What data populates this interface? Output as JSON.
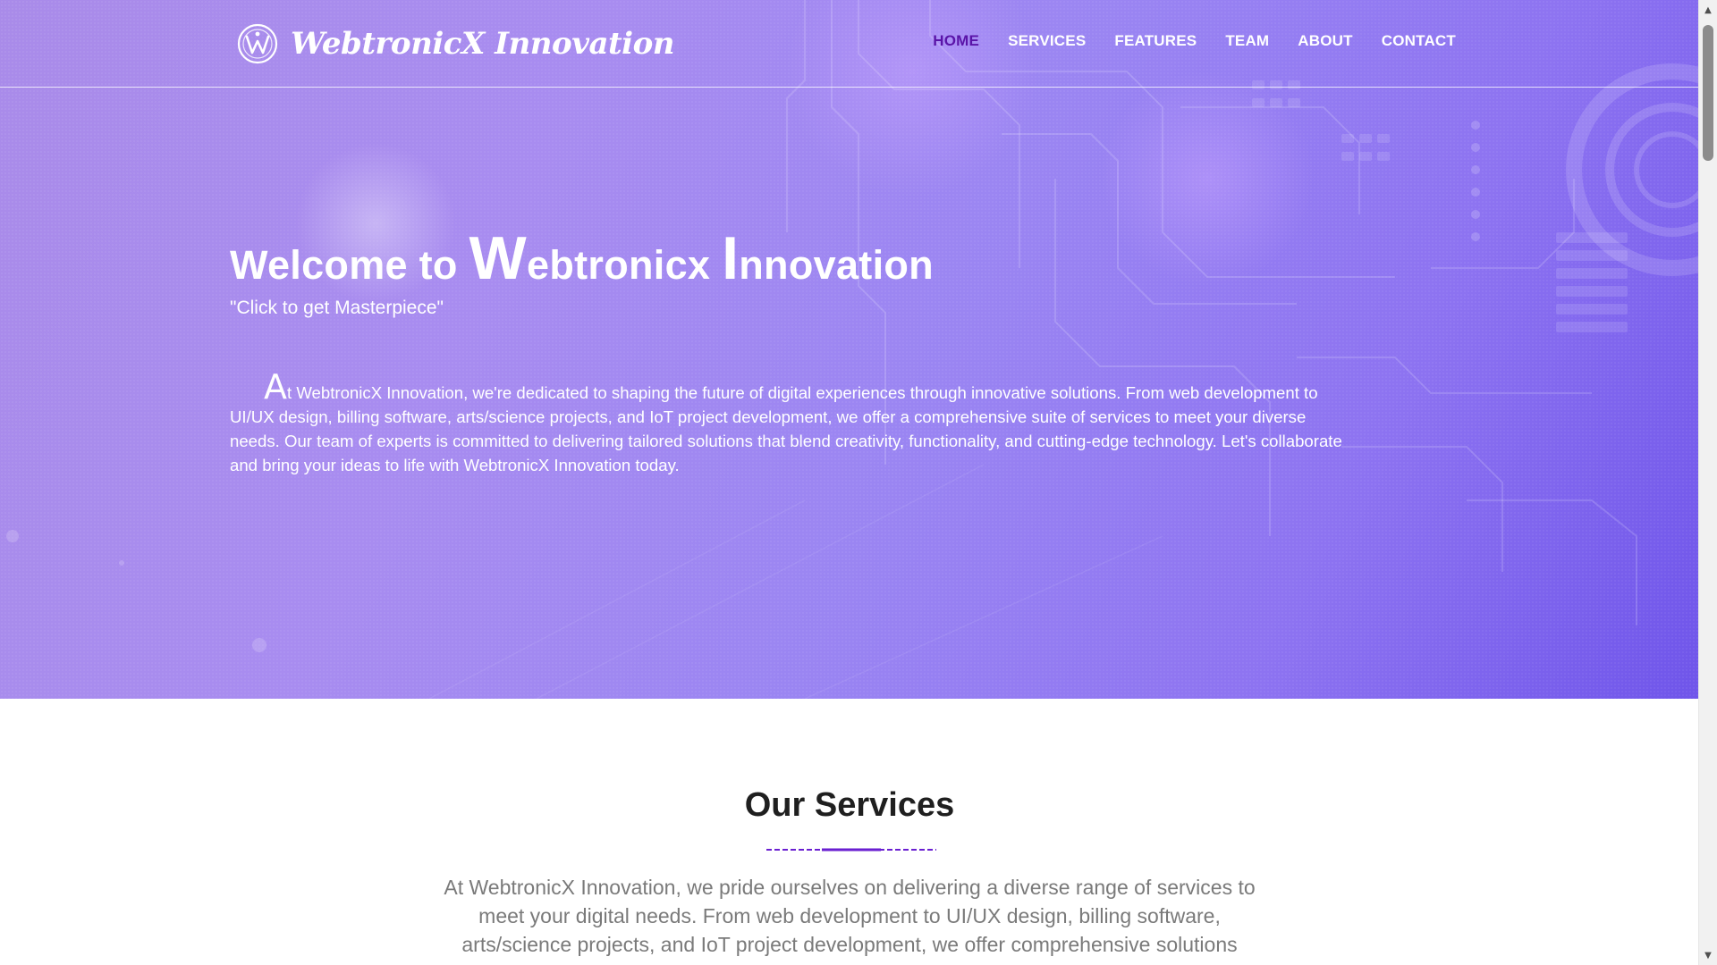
{
  "brand": {
    "name": "WebtronicX Innovation",
    "logo_icon": "webtronicx-logo-icon"
  },
  "nav": {
    "items": [
      {
        "label": "HOME",
        "active": true
      },
      {
        "label": "SERVICES",
        "active": false
      },
      {
        "label": "FEATURES",
        "active": false
      },
      {
        "label": "TEAM",
        "active": false
      },
      {
        "label": "ABOUT",
        "active": false
      },
      {
        "label": "CONTACT",
        "active": false
      }
    ]
  },
  "hero": {
    "title_prefix": "Welcome to ",
    "title_w": "W",
    "title_rest1": "ebtronicx ",
    "title_i": "I",
    "title_rest2": "nnovation",
    "tagline": "\"Click to get Masterpiece\"",
    "desc_dropcap": "A",
    "desc_rest": "t WebtronicX Innovation, we're dedicated to shaping the future of digital experiences through innovative solutions. From web development to UI/UX design, billing software, arts/science projects, and IoT project development, we offer a comprehensive suite of services to meet your diverse needs. Our team of experts is committed to delivering tailored solutions that blend creativity, functionality, and cutting-edge technology. Let's collaborate and bring your ideas to life with WebtronicX Innovation today."
  },
  "services": {
    "title": "Our Services",
    "intro": "At WebtronicX Innovation, we pride ourselves on delivering a diverse range of services to meet your digital needs. From web development to UI/UX design, billing software, arts/science projects, and IoT project development, we offer comprehensive solutions"
  },
  "colors": {
    "accent": "#6a1fd1",
    "nav_active": "#5a14a8",
    "hero_start": "#a98be9",
    "hero_end": "#6f55ea"
  },
  "scrollbar": {
    "up_icon": "scroll-up-arrow-icon",
    "down_icon": "scroll-down-arrow-icon"
  }
}
